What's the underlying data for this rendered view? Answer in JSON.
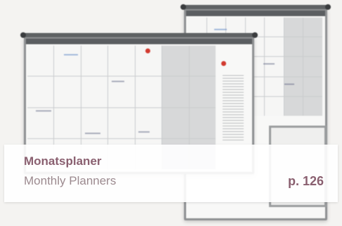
{
  "caption": {
    "title": "Monatsplaner",
    "subtitle": "Monthly Planners",
    "page_ref": "p. 126"
  },
  "colors": {
    "title": "#8a6070",
    "subtitle": "#9c8a8f",
    "board_frame": "#8e9092",
    "marker_red": "#d23a2f",
    "marker_blue": "#5f86c4"
  }
}
